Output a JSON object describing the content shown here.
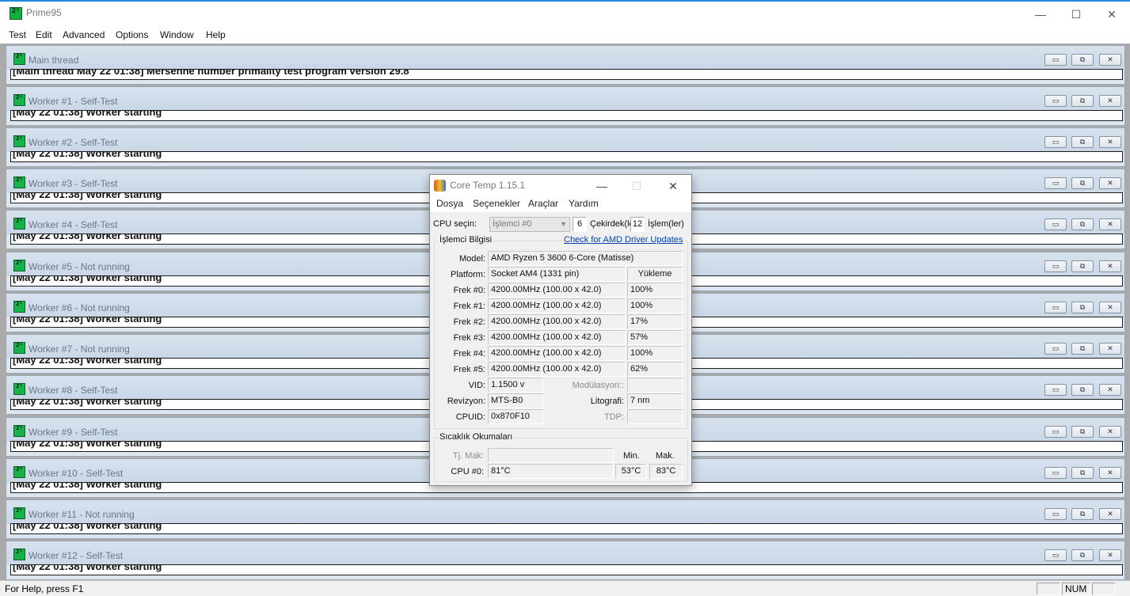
{
  "app": {
    "title": "Prime95",
    "controls": {
      "minimize": "—",
      "maximize": "☐",
      "close": "✕"
    },
    "menu": [
      "Test",
      "Edit",
      "Advanced",
      "Options",
      "Window",
      "Help"
    ]
  },
  "icon_text": "2¹",
  "child_buttons": {
    "minimize": "▭",
    "restore": "⧉",
    "close": "✕"
  },
  "children": [
    {
      "title": "Main thread",
      "log": "[Main thread May 22 01:38] Mersenne number primality test program version 29.8"
    },
    {
      "title": "Worker #1 - Self-Test",
      "log": "[May 22 01:38] Worker starting"
    },
    {
      "title": "Worker #2 - Self-Test",
      "log": "[May 22 01:38] Worker starting"
    },
    {
      "title": "Worker #3 - Self-Test",
      "log": "[May 22 01:38] Worker starting"
    },
    {
      "title": "Worker #4 - Self-Test",
      "log": "[May 22 01:38] Worker starting"
    },
    {
      "title": "Worker #5 - Not running",
      "log": "[May 22 01:38] Worker starting"
    },
    {
      "title": "Worker #6 - Not running",
      "log": "[May 22 01:38] Worker starting"
    },
    {
      "title": "Worker #7 - Not running",
      "log": "[May 22 01:38] Worker starting"
    },
    {
      "title": "Worker #8 - Self-Test",
      "log": "[May 22 01:38] Worker starting"
    },
    {
      "title": "Worker #9 - Self-Test",
      "log": "[May 22 01:38] Worker starting"
    },
    {
      "title": "Worker #10 - Self-Test",
      "log": "[May 22 01:38] Worker starting"
    },
    {
      "title": "Worker #11 - Not running",
      "log": "[May 22 01:38] Worker starting"
    },
    {
      "title": "Worker #12 - Self-Test",
      "log": "[May 22 01:38] Worker starting"
    }
  ],
  "statusbar": {
    "help": "For Help, press F1",
    "num": "NUM"
  },
  "coretemp": {
    "title": "Core Temp 1.15.1",
    "controls": {
      "minimize": "—",
      "maximize": "☐",
      "close": "✕"
    },
    "menu": [
      "Dosya",
      "Seçenekler",
      "Araçlar",
      "Yardım"
    ],
    "cpu_select_label": "CPU seçin:",
    "cpu_select_value": "İşlemci #0",
    "cores_value": "6",
    "cores_label": "Çekirdek(ler)",
    "threads_value": "12",
    "threads_label": "İşlem(ler)",
    "info_group": "İşlemci Bilgisi",
    "amd_link": "Check for AMD Driver Updates",
    "model_label": "Model:",
    "model": "AMD Ryzen 5 3600 6-Core (Matisse)",
    "platform_label": "Platform:",
    "platform": "Socket AM4 (1331 pin)",
    "load_header": "Yükleme",
    "freqs": [
      {
        "label": "Frek #0:",
        "value": "4200.00MHz (100.00 x 42.0)",
        "load": "100%"
      },
      {
        "label": "Frek #1:",
        "value": "4200.00MHz (100.00 x 42.0)",
        "load": "100%"
      },
      {
        "label": "Frek #2:",
        "value": "4200.00MHz (100.00 x 42.0)",
        "load": "17%"
      },
      {
        "label": "Frek #3:",
        "value": "4200.00MHz (100.00 x 42.0)",
        "load": "57%"
      },
      {
        "label": "Frek #4:",
        "value": "4200.00MHz (100.00 x 42.0)",
        "load": "100%"
      },
      {
        "label": "Frek #5:",
        "value": "4200.00MHz (100.00 x 42.0)",
        "load": "62%"
      }
    ],
    "vid_label": "VID:",
    "vid": "1.1500 v",
    "modulation_label": "Modülasyon::",
    "revision_label": "Revizyon:",
    "revision": "MTS-B0",
    "litho_label": "Litografi:",
    "litho": "7 nm",
    "cpuid_label": "CPUID:",
    "cpuid": "0x870F10",
    "tdp_label": "TDP:",
    "temp_group": "Sıcaklık Okumaları",
    "tjmax_label": "Tj. Mak:",
    "min_header": "Min.",
    "max_header": "Mak.",
    "cpu0_label": "CPU #0:",
    "cpu0_temp": "81°C",
    "cpu0_min": "53°C",
    "cpu0_max": "83°C"
  }
}
